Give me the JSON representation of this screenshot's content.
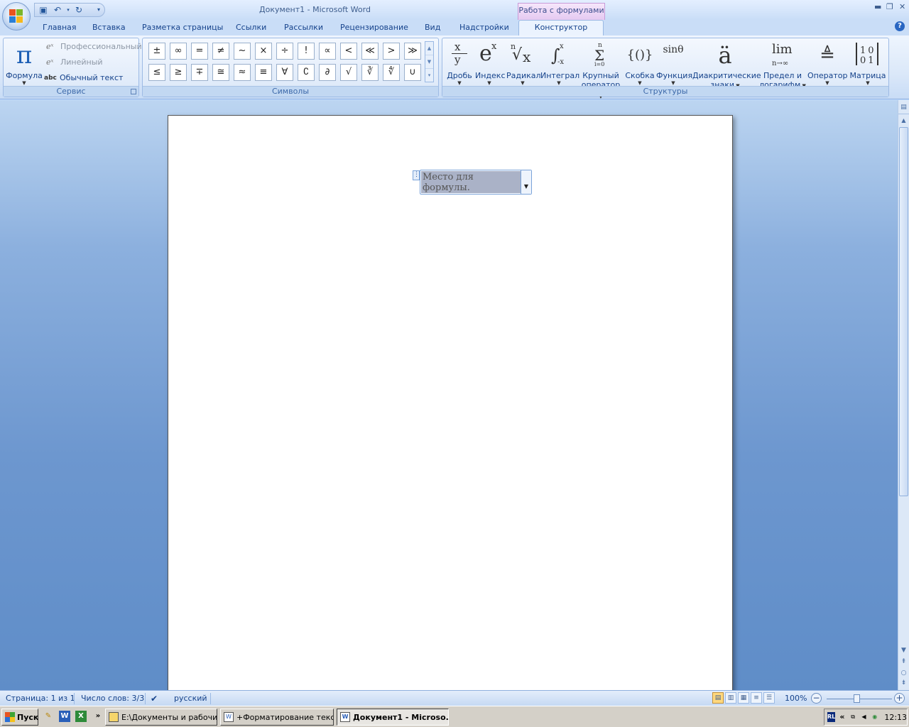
{
  "window": {
    "title": "Документ1 - Microsoft Word",
    "context_tab_group": "Работа с формулами"
  },
  "tabs": [
    {
      "label": "Главная"
    },
    {
      "label": "Вставка"
    },
    {
      "label": "Разметка страницы"
    },
    {
      "label": "Ссылки"
    },
    {
      "label": "Рассылки"
    },
    {
      "label": "Рецензирование"
    },
    {
      "label": "Вид"
    },
    {
      "label": "Надстройки"
    },
    {
      "label": "Конструктор",
      "active": true
    }
  ],
  "ribbon": {
    "service": {
      "label": "Сервис",
      "formula_label": "Формула",
      "professional": "Профессиональный",
      "linear": "Линейный",
      "plain_text": "Обычный текст",
      "abc": "abc"
    },
    "symbols": {
      "label": "Символы",
      "items": [
        "±",
        "∞",
        "=",
        "≠",
        "~",
        "×",
        "÷",
        "!",
        "∝",
        "<",
        "≪",
        ">",
        "≫",
        "≤",
        "≥",
        "∓",
        "≅",
        "≈",
        "≡",
        "∀",
        "∁",
        "∂",
        "√",
        "∛",
        "∜",
        "∪"
      ]
    },
    "structures": {
      "label": "Структуры",
      "items": [
        {
          "label": "Дробь",
          "glyph": "x/y"
        },
        {
          "label": "Индекс",
          "glyph": "eˣ"
        },
        {
          "label": "Радикал",
          "glyph": "ⁿ√x"
        },
        {
          "label": "Интеграл",
          "glyph": "∫"
        },
        {
          "label": "Крупный оператор",
          "glyph": "Σ"
        },
        {
          "label": "Скобка",
          "glyph": "{()}"
        },
        {
          "label": "Функция",
          "glyph": "sinθ"
        },
        {
          "label": "Диакритические знаки",
          "glyph": "ä"
        },
        {
          "label": "Предел и логарифм",
          "glyph": "lim"
        },
        {
          "label": "Оператор",
          "glyph": "≜"
        },
        {
          "label": "Матрица",
          "glyph": "[10 01]"
        }
      ],
      "structure_labels": {
        "frac_x": "x",
        "frac_y": "y",
        "idx_base": "e",
        "idx_sup": "x",
        "rad_n": "n",
        "rad_x": "x",
        "int_sup": "x",
        "int_sub": "-x",
        "sum_sup": "n",
        "sum_sub": "i=0",
        "lim_sub": "n→∞",
        "large_op_line1": "Крупный",
        "large_op_line2": "оператор",
        "diacritic_line1": "Диакритические",
        "diacritic_line2": "знаки",
        "limit_line1": "Предел и",
        "limit_line2": "логарифм",
        "matrix_row1": "10",
        "matrix_row2": "01"
      }
    }
  },
  "document": {
    "equation_placeholder": "Место для формулы."
  },
  "statusbar": {
    "page": "Страница: 1 из 1",
    "words": "Число слов: 3/3",
    "language": "русский",
    "zoom": "100%",
    "zoom_minus": "−",
    "zoom_plus": "+"
  },
  "taskbar": {
    "start": "Пуск",
    "more": "»",
    "tasks": [
      {
        "label": "E:\\Документы и рабочи..."
      },
      {
        "label": "+Форматирование текс..."
      },
      {
        "label": "Документ1 - Microso...",
        "active": true
      }
    ],
    "tray_arrow": "«",
    "tray_lang": "RL",
    "clock": "12:13"
  }
}
